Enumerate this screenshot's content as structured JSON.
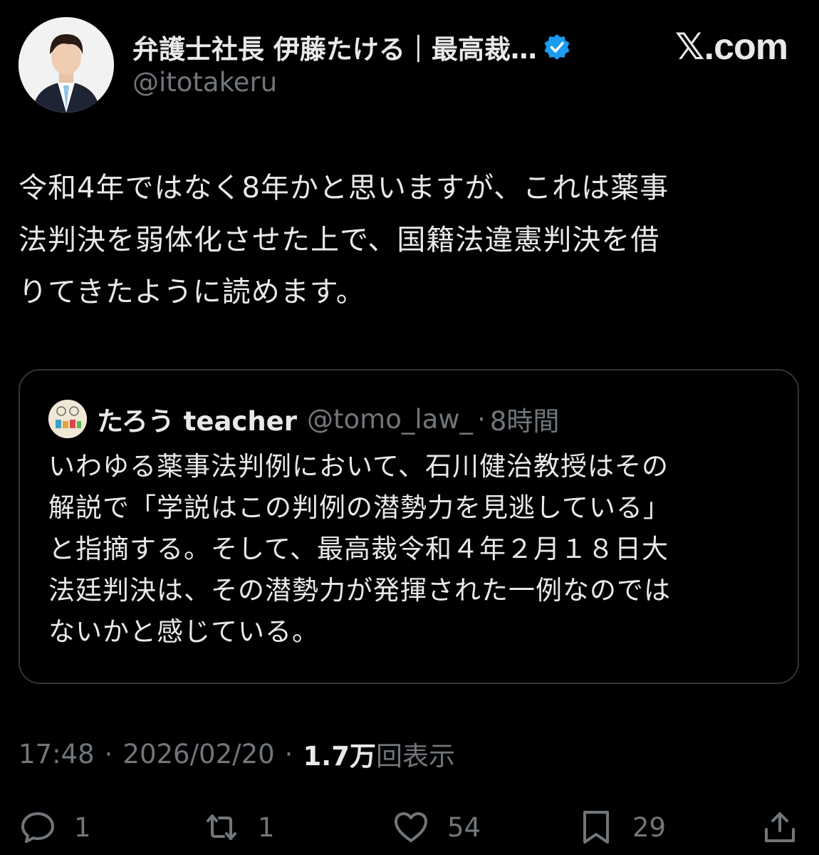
{
  "post": {
    "author": {
      "display_name": "弁護士社長 伊藤たける｜最高裁…",
      "handle": "@itotakeru",
      "verified": true
    },
    "brand": "𝕏.com",
    "text_lines": [
      "令和4年ではなく8年かと思いますが、これは薬事",
      "法判決を弱体化させた上で、国籍法違憲判決を借",
      "りてきたように読めます。"
    ],
    "quote": {
      "name": "たろう teacher",
      "handle": "@tomo_law_",
      "separator": "·",
      "time": "8時間",
      "text_lines": [
        "いわゆる薬事法判例において、石川健治教授はその",
        "解説で「学説はこの判例の潜勢力を見逃している」",
        "と指摘する。そして、最高裁令和４年２月１８日大",
        "法廷判決は、その潜勢力が発揮された一例なのでは",
        "ないかと感じている。"
      ]
    },
    "meta": {
      "time": "17:48",
      "dot1": "·",
      "date": "2026/02/20",
      "dot2": "·",
      "views_count": "1.7万",
      "views_label": "回表示"
    },
    "actions": {
      "replies": "1",
      "reposts": "1",
      "likes": "54",
      "bookmarks": "29"
    }
  },
  "colors": {
    "background": "#000000",
    "text": "#e7e9ea",
    "secondary": "#71767b",
    "border": "#2f3336",
    "verified": "#1d9bf0"
  },
  "icons": [
    "verified-badge-icon",
    "reply-icon",
    "repost-icon",
    "like-icon",
    "bookmark-icon",
    "share-icon"
  ]
}
